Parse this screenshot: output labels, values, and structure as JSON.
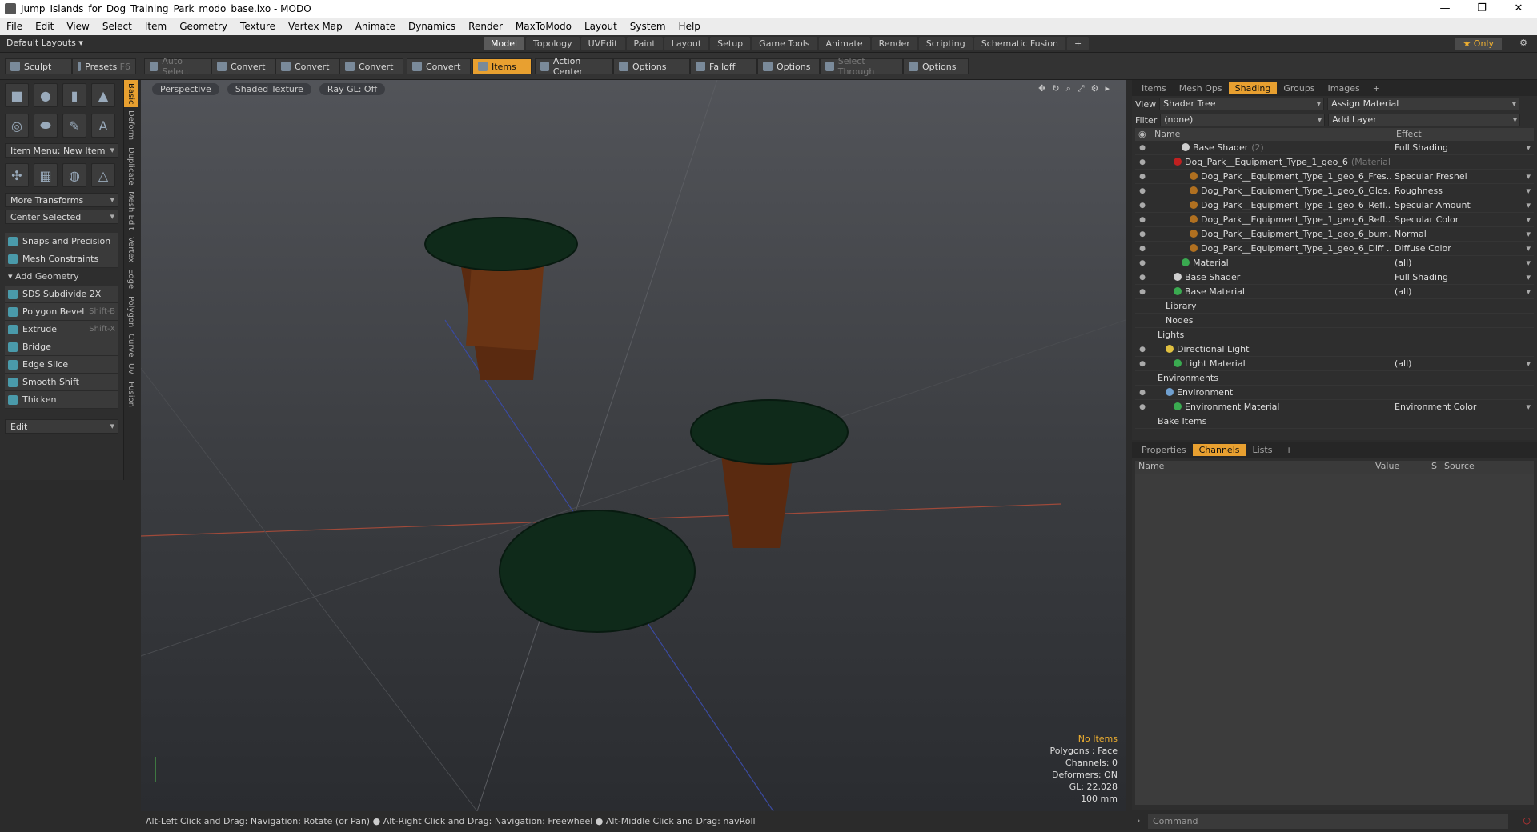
{
  "window": {
    "title": "Jump_Islands_for_Dog_Training_Park_modo_base.lxo - MODO"
  },
  "menu": [
    "File",
    "Edit",
    "View",
    "Select",
    "Item",
    "Geometry",
    "Texture",
    "Vertex Map",
    "Animate",
    "Dynamics",
    "Render",
    "MaxToModo",
    "Layout",
    "System",
    "Help"
  ],
  "layout": {
    "default_layouts": "Default Layouts",
    "tabs": [
      "Model",
      "Topology",
      "UVEdit",
      "Paint",
      "Layout",
      "Setup",
      "Game Tools",
      "Animate",
      "Render",
      "Scripting",
      "Schematic Fusion"
    ],
    "active_tab": "Model",
    "only_label": "Only"
  },
  "toolbar": {
    "sculpt": "Sculpt",
    "presets": "Presets",
    "presets_key": "F6",
    "auto_select": "Auto Select",
    "convert1": "Convert",
    "convert2": "Convert",
    "convert3": "Convert",
    "convert4": "Convert",
    "items": "Items",
    "action_center": "Action Center",
    "options1": "Options",
    "falloff": "Falloff",
    "options2": "Options",
    "select_through": "Select Through",
    "options3": "Options"
  },
  "left": {
    "item_menu": "Item Menu: New Item",
    "more_transforms": "More Transforms",
    "center_selected": "Center Selected",
    "snaps": "Snaps and Precision",
    "mesh_constraints": "Mesh Constraints",
    "add_geometry": "Add Geometry",
    "tools": [
      {
        "label": "SDS Subdivide 2X",
        "shortcut": ""
      },
      {
        "label": "Polygon Bevel",
        "shortcut": "Shift-B"
      },
      {
        "label": "Extrude",
        "shortcut": "Shift-X"
      },
      {
        "label": "Bridge",
        "shortcut": ""
      },
      {
        "label": "Edge Slice",
        "shortcut": ""
      },
      {
        "label": "Smooth Shift",
        "shortcut": ""
      },
      {
        "label": "Thicken",
        "shortcut": ""
      }
    ],
    "edit": "Edit",
    "vtabs": [
      "Basic",
      "Deform",
      "Duplicate",
      "Mesh Edit",
      "Vertex",
      "Edge",
      "Polygon",
      "Curve",
      "UV",
      "Fusion"
    ]
  },
  "viewport": {
    "perspective": "Perspective",
    "shaded": "Shaded Texture",
    "raygl": "Ray GL: Off",
    "stats": {
      "no_items": "No Items",
      "polygons": "Polygons : Face",
      "channels": "Channels: 0",
      "deformers": "Deformers: ON",
      "gl": "GL: 22,028",
      "scale": "100 mm"
    }
  },
  "status": "Alt-Left Click and Drag: Navigation: Rotate (or Pan) ● Alt-Right Click and Drag: Navigation: Freewheel ● Alt-Middle Click and Drag: navRoll",
  "shading": {
    "tabs": [
      "Items",
      "Mesh Ops",
      "Shading",
      "Groups",
      "Images"
    ],
    "active_tab": "Shading",
    "view_label": "View",
    "view_value": "Shader Tree",
    "assign": "Assign Material",
    "filter_label": "Filter",
    "filter_value": "(none)",
    "add_layer": "Add Layer",
    "col_name": "Name",
    "col_effect": "Effect",
    "rows": [
      {
        "name": "Base Shader",
        "tag": "(2)",
        "effect": "Full Shading",
        "indent": 4,
        "ball": "#cfcfcf"
      },
      {
        "name": "Dog_Park__Equipment_Type_1_geo_6",
        "tag": "(Material)",
        "effect": "",
        "indent": 3,
        "ball": "#c02020"
      },
      {
        "name": "Dog_Park__Equipment_Type_1_geo_6_Fres...",
        "tag": "",
        "effect": "Specular Fresnel",
        "indent": 5,
        "ball": "#b07020"
      },
      {
        "name": "Dog_Park__Equipment_Type_1_geo_6_Glos...",
        "tag": "",
        "effect": "Roughness",
        "indent": 5,
        "ball": "#b07020"
      },
      {
        "name": "Dog_Park__Equipment_Type_1_geo_6_Refl...",
        "tag": "",
        "effect": "Specular Amount",
        "indent": 5,
        "ball": "#b07020"
      },
      {
        "name": "Dog_Park__Equipment_Type_1_geo_6_Refl...",
        "tag": "",
        "effect": "Specular Color",
        "indent": 5,
        "ball": "#b07020"
      },
      {
        "name": "Dog_Park__Equipment_Type_1_geo_6_bum...",
        "tag": "",
        "effect": "Normal",
        "indent": 5,
        "ball": "#b07020"
      },
      {
        "name": "Dog_Park__Equipment_Type_1_geo_6_Diff ...",
        "tag": "",
        "effect": "Diffuse Color",
        "indent": 5,
        "ball": "#b07020"
      },
      {
        "name": "Material",
        "tag": "",
        "effect": "(all)",
        "indent": 4,
        "ball": "#3aaa50"
      },
      {
        "name": "Base Shader",
        "tag": "",
        "effect": "Full Shading",
        "indent": 3,
        "ball": "#cfcfcf"
      },
      {
        "name": "Base Material",
        "tag": "",
        "effect": "(all)",
        "indent": 3,
        "ball": "#3aaa50"
      },
      {
        "name": "Library",
        "tag": "",
        "effect": "",
        "indent": 2,
        "ball": ""
      },
      {
        "name": "Nodes",
        "tag": "",
        "effect": "",
        "indent": 2,
        "ball": ""
      },
      {
        "name": "Lights",
        "tag": "",
        "effect": "",
        "indent": 1,
        "ball": ""
      },
      {
        "name": "Directional Light",
        "tag": "",
        "effect": "",
        "indent": 2,
        "ball": "#e0c040"
      },
      {
        "name": "Light Material",
        "tag": "",
        "effect": "(all)",
        "indent": 3,
        "ball": "#3aaa50"
      },
      {
        "name": "Environments",
        "tag": "",
        "effect": "",
        "indent": 1,
        "ball": ""
      },
      {
        "name": "Environment",
        "tag": "",
        "effect": "",
        "indent": 2,
        "ball": "#70a0d0"
      },
      {
        "name": "Environment Material",
        "tag": "",
        "effect": "Environment Color",
        "indent": 3,
        "ball": "#3aaa50"
      },
      {
        "name": "Bake Items",
        "tag": "",
        "effect": "",
        "indent": 1,
        "ball": ""
      }
    ]
  },
  "channels": {
    "tabs": [
      "Properties",
      "Channels",
      "Lists"
    ],
    "active_tab": "Channels",
    "cols": [
      "Name",
      "Value",
      "S",
      "Source"
    ]
  },
  "command": {
    "placeholder": "Command"
  }
}
